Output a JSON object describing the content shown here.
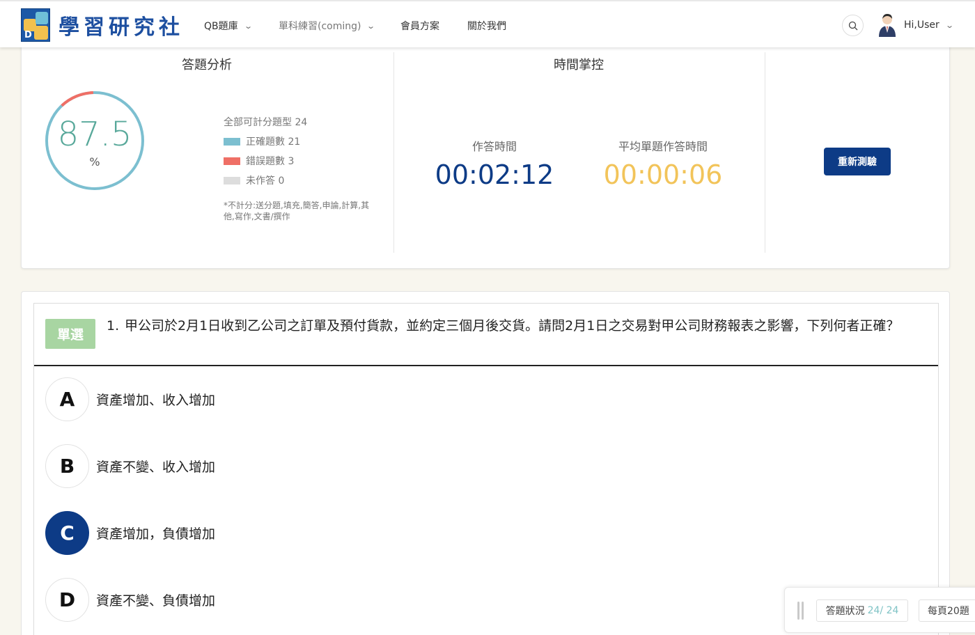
{
  "header": {
    "logo_text": "學習研究社",
    "nav": [
      {
        "label": "QB題庫"
      },
      {
        "label": "單科練習(coming)"
      },
      {
        "label": "會員方案"
      },
      {
        "label": "關於我們"
      }
    ],
    "user_label": "Hi,User"
  },
  "analysis": {
    "title": "答題分析",
    "score": "87.5",
    "score_unit": "%",
    "score_fraction": 0.875,
    "total_label": "全部可計分題型 24",
    "legend": [
      {
        "label": "正確題數 21",
        "color": "#7cbfd0"
      },
      {
        "label": "錯誤題數 3",
        "color": "#ef6f66"
      },
      {
        "label": "未作答 0",
        "color": "#dddddd"
      }
    ],
    "note": "*不計分:送分題,填充,簡答,申論,計算,其他,寫作,文書/撰作"
  },
  "time": {
    "title": "時間掌控",
    "answer_time_label": "作答時間",
    "answer_time": "00:02:12",
    "avg_time_label": "平均單題作答時間",
    "avg_time": "00:00:06",
    "answer_color": "#0d3b86",
    "avg_color": "#f2c45a"
  },
  "actions": {
    "retry_label": "重新測驗"
  },
  "question": {
    "type_label": "單選",
    "number": "1.",
    "text": "甲公司於2月1日收到乙公司之訂單及預付貨款，並約定三個月後交貨。請問2月1日之交易對甲公司財務報表之影響，下列何者正確？",
    "options": [
      {
        "letter": "A",
        "text": "資產增加、收入增加",
        "selected": false
      },
      {
        "letter": "B",
        "text": "資產不變、收入增加",
        "selected": false
      },
      {
        "letter": "C",
        "text": "資產增加，負債增加",
        "selected": true
      },
      {
        "letter": "D",
        "text": "資產不變、負債增加",
        "selected": false
      }
    ]
  },
  "status": {
    "label": "答題狀況",
    "count": "24/ 24",
    "per_page": "每頁20題"
  }
}
